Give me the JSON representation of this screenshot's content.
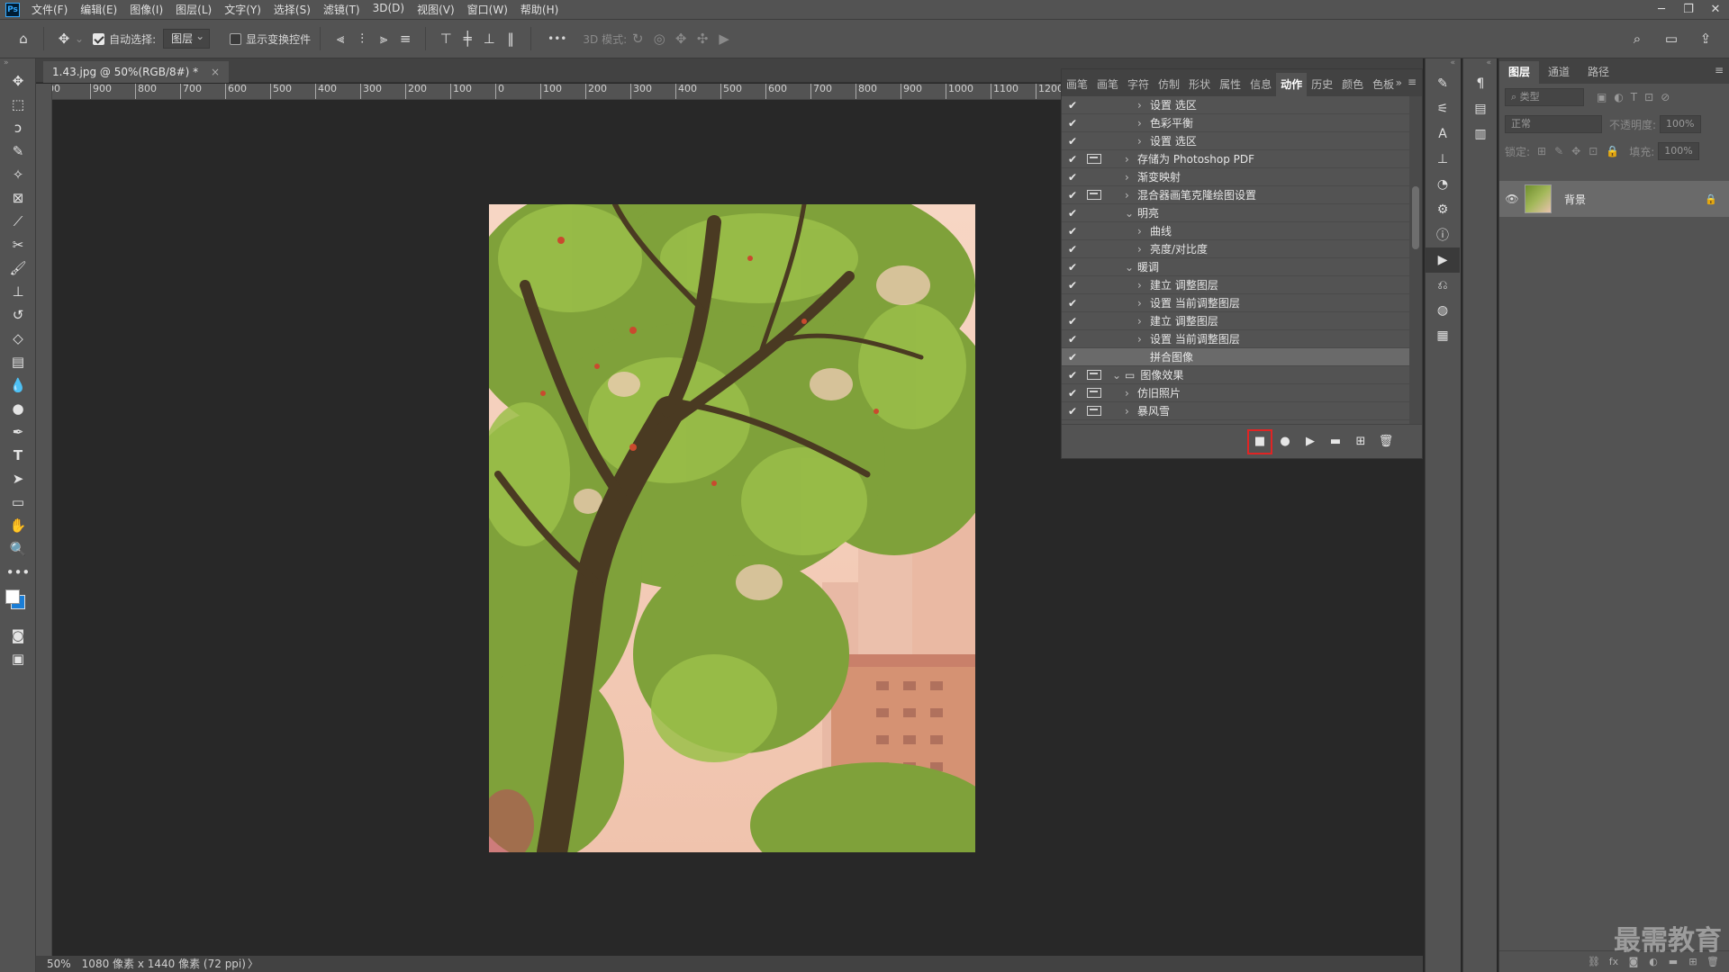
{
  "app": {
    "logo": "Ps"
  },
  "menu": [
    "文件(F)",
    "编辑(E)",
    "图像(I)",
    "图层(L)",
    "文字(Y)",
    "选择(S)",
    "滤镜(T)",
    "3D(D)",
    "视图(V)",
    "窗口(W)",
    "帮助(H)"
  ],
  "window_controls": {
    "minimize": "─",
    "restore": "❐",
    "close": "✕"
  },
  "options": {
    "auto_select_label": "自动选择:",
    "auto_select_checked": true,
    "auto_select_target": "图层",
    "show_transform_label": "显示变换控件",
    "show_transform_checked": false,
    "more": "•••",
    "mode_3d_label": "3D 模式:"
  },
  "document": {
    "tab_title": "1.43.jpg @ 50%(RGB/8#) *",
    "close": "×",
    "ruler_labels": [
      "00",
      "900",
      "800",
      "700",
      "600",
      "500",
      "400",
      "300",
      "200",
      "100",
      "0",
      "100",
      "200",
      "300",
      "400",
      "500",
      "600",
      "700",
      "800",
      "900",
      "1000",
      "1100",
      "1200"
    ]
  },
  "status": {
    "zoom": "50%",
    "info": "1080 像素 x 1440 像素 (72 ppi)",
    "arrow": "〉"
  },
  "actions_panel": {
    "tabs": [
      {
        "label": "画笔",
        "active": false
      },
      {
        "label": "画笔",
        "active": false
      },
      {
        "label": "字符",
        "active": false
      },
      {
        "label": "仿制",
        "active": false
      },
      {
        "label": "形状",
        "active": false
      },
      {
        "label": "属性",
        "active": false
      },
      {
        "label": "信息",
        "active": false
      },
      {
        "label": "动作",
        "active": true
      },
      {
        "label": "历史",
        "active": false
      },
      {
        "label": "颜色",
        "active": false
      },
      {
        "label": "色板",
        "active": false
      }
    ],
    "rows": [
      {
        "label": "设置 选区",
        "indent": 2,
        "caret": "›",
        "dialog": false,
        "selected": false
      },
      {
        "label": "色彩平衡",
        "indent": 2,
        "caret": "›",
        "dialog": false,
        "selected": false
      },
      {
        "label": "设置 选区",
        "indent": 2,
        "caret": "›",
        "dialog": false,
        "selected": false
      },
      {
        "label": "存储为 Photoshop PDF",
        "indent": 1,
        "caret": "›",
        "dialog": true,
        "selected": false
      },
      {
        "label": "渐变映射",
        "indent": 1,
        "caret": "›",
        "dialog": false,
        "selected": false
      },
      {
        "label": "混合器画笔克隆绘图设置",
        "indent": 1,
        "caret": "›",
        "dialog": true,
        "selected": false
      },
      {
        "label": "明亮",
        "indent": 1,
        "caret": "⌄",
        "dialog": false,
        "selected": false
      },
      {
        "label": "曲线",
        "indent": 2,
        "caret": "›",
        "dialog": false,
        "selected": false
      },
      {
        "label": "亮度/对比度",
        "indent": 2,
        "caret": "›",
        "dialog": false,
        "selected": false
      },
      {
        "label": "暖调",
        "indent": 1,
        "caret": "⌄",
        "dialog": false,
        "selected": false
      },
      {
        "label": "建立 调整图层",
        "indent": 2,
        "caret": "›",
        "dialog": false,
        "selected": false
      },
      {
        "label": "设置 当前调整图层",
        "indent": 2,
        "caret": "›",
        "dialog": false,
        "selected": false
      },
      {
        "label": "建立 调整图层",
        "indent": 2,
        "caret": "›",
        "dialog": false,
        "selected": false
      },
      {
        "label": "设置 当前调整图层",
        "indent": 2,
        "caret": "›",
        "dialog": false,
        "selected": false
      },
      {
        "label": "拼合图像",
        "indent": 2,
        "caret": "",
        "dialog": false,
        "selected": true
      },
      {
        "label": "图像效果",
        "indent": 0,
        "caret": "⌄",
        "dialog": true,
        "selected": false,
        "folder": true
      },
      {
        "label": "仿旧照片",
        "indent": 1,
        "caret": "›",
        "dialog": true,
        "selected": false
      },
      {
        "label": "暴风雪",
        "indent": 1,
        "caret": "›",
        "dialog": true,
        "selected": false
      }
    ],
    "buttons": [
      {
        "name": "stop-recording-button",
        "glyph": "■"
      },
      {
        "name": "record-button",
        "glyph": "●"
      },
      {
        "name": "play-button",
        "glyph": "▶"
      },
      {
        "name": "new-set-button",
        "glyph": "▬"
      },
      {
        "name": "new-action-button",
        "glyph": "⊞"
      },
      {
        "name": "delete-action-button",
        "glyph": "🗑"
      }
    ]
  },
  "layers_panel": {
    "tabs": [
      {
        "label": "图层",
        "active": true
      },
      {
        "label": "通道",
        "active": false
      },
      {
        "label": "路径",
        "active": false
      }
    ],
    "filter_placeholder": "类型",
    "blend_mode": "正常",
    "opacity_label": "不透明度:",
    "opacity_value": "100%",
    "lock_label": "锁定:",
    "fill_label": "填充:",
    "fill_value": "100%",
    "layers": [
      {
        "name": "背景",
        "visible": true,
        "locked": true
      }
    ],
    "bottom_icons": [
      "⛓",
      "fx",
      "◙",
      "◐",
      "▬",
      "⊞",
      "🗑"
    ]
  },
  "watermark": "最需教育",
  "colors": {
    "panel": "#535353",
    "canvas": "#282828",
    "highlight": "#e02424",
    "accent": "#31a8ff"
  }
}
